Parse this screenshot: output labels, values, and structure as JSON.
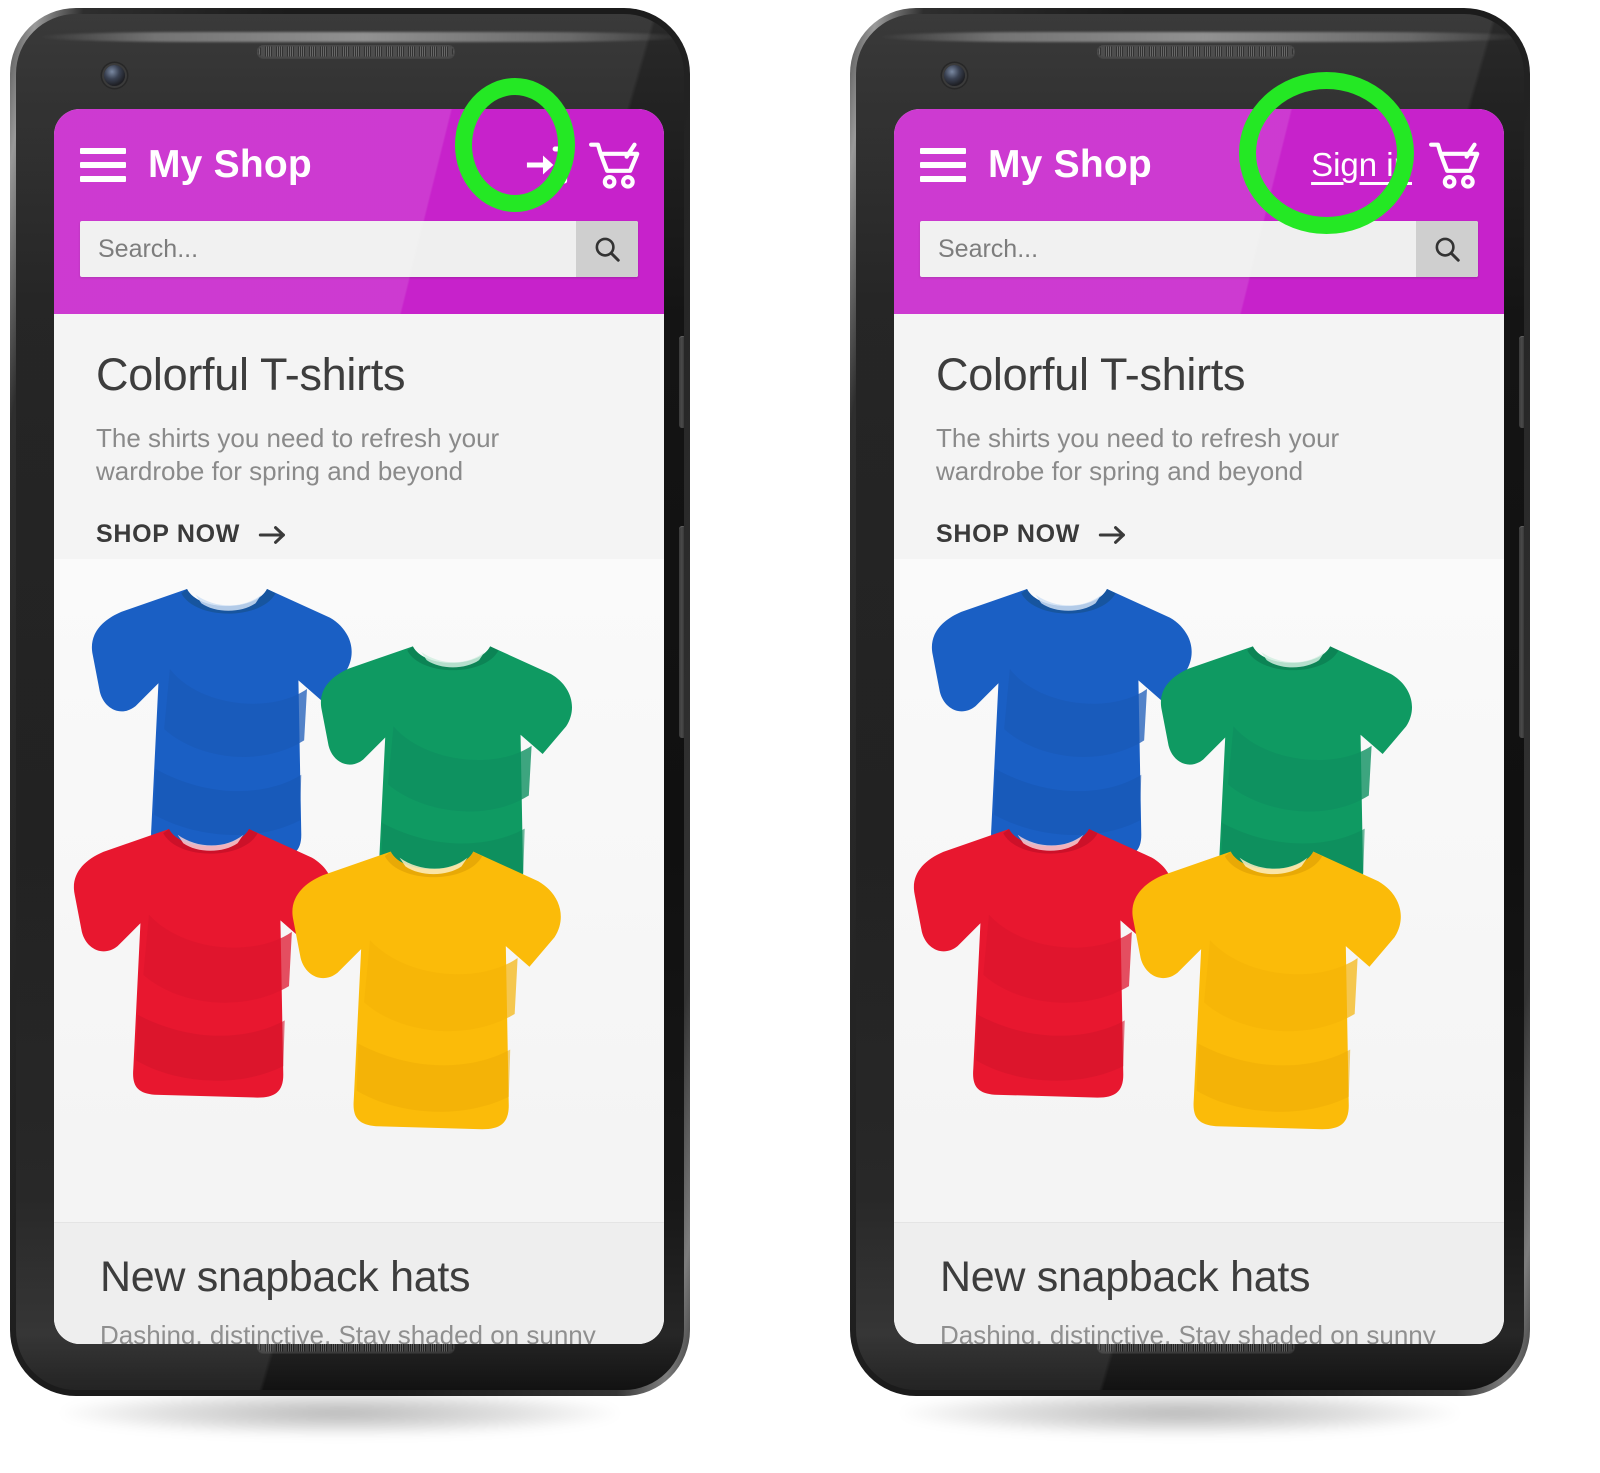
{
  "highlight_color": "#24e824",
  "brand_color": "#c722cb",
  "phones": [
    {
      "id": "phone-left",
      "appbar": {
        "menu_icon": "hamburger-menu-icon",
        "title": "My Shop",
        "action_type": "icon",
        "action_icon": "login-arrow-icon",
        "action_label": "",
        "cart_icon": "shopping-cart-icon"
      },
      "search": {
        "placeholder": "Search...",
        "value": "",
        "button_icon": "search-icon"
      },
      "hero": {
        "title": "Colorful T-shirts",
        "subtitle": "The shirts you need to refresh your wardrobe for spring and beyond",
        "cta_label": "SHOP NOW",
        "cta_icon": "arrow-right-icon"
      },
      "next_section": {
        "title": "New snapback hats",
        "subtitle": "Dashing, distinctive. Stay shaded on sunny"
      }
    },
    {
      "id": "phone-right",
      "appbar": {
        "menu_icon": "hamburger-menu-icon",
        "title": "My Shop",
        "action_type": "text",
        "action_icon": "",
        "action_label": "Sign in",
        "cart_icon": "shopping-cart-icon"
      },
      "search": {
        "placeholder": "Search...",
        "value": "",
        "button_icon": "search-icon"
      },
      "hero": {
        "title": "Colorful T-shirts",
        "subtitle": "The shirts you need to refresh your wardrobe for spring and beyond",
        "cta_label": "SHOP NOW",
        "cta_icon": "arrow-right-icon"
      },
      "next_section": {
        "title": "New snapback hats",
        "subtitle": "Dashing, distinctive. Stay shaded on sunny"
      }
    }
  ],
  "product_photo": {
    "alt": "Four folded t-shirts",
    "shirts": [
      {
        "color_name": "blue",
        "hex": "#1a5fc4",
        "position": "top-left"
      },
      {
        "color_name": "green",
        "hex": "#0f9a62",
        "position": "top-right"
      },
      {
        "color_name": "red",
        "hex": "#e8172f",
        "position": "bottom-left"
      },
      {
        "color_name": "yellow",
        "hex": "#fbbb09",
        "position": "bottom-right"
      }
    ]
  }
}
